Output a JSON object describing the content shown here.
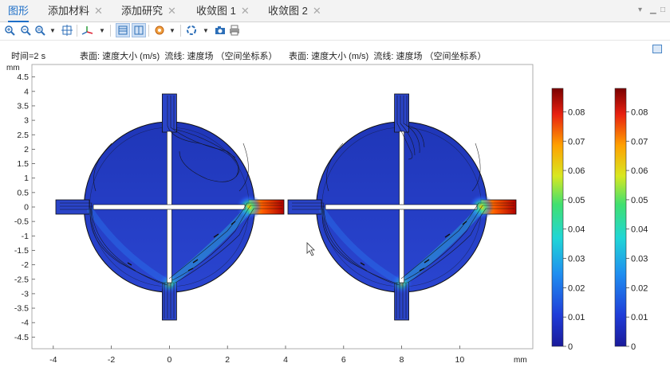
{
  "tabs": [
    {
      "label": "图形",
      "active": true,
      "closable": false
    },
    {
      "label": "添加材料",
      "active": false,
      "closable": true
    },
    {
      "label": "添加研究",
      "active": false,
      "closable": true
    },
    {
      "label": "收敛图 1",
      "active": false,
      "closable": true
    },
    {
      "label": "收敛图 2",
      "active": false,
      "closable": true
    }
  ],
  "toolbar": {
    "icons": [
      "zoom-in-icon",
      "zoom-out-icon",
      "zoom-box-icon",
      "zoom-extents-icon",
      "axis-orientation-icon",
      "grid-view-icon",
      "split-view-icon",
      "transparency-icon",
      "scene-light-icon",
      "camera-icon",
      "print-icon"
    ]
  },
  "plot": {
    "time_label": "时间=2 s",
    "left_title": "表面: 速度大小 (m/s)  流线: 速度场 （空间坐标系）",
    "right_title": "表面: 速度大小 (m/s)  流线: 速度场 （空间坐标系）",
    "unit": "mm",
    "x_ticks": [
      -4,
      -2,
      0,
      2,
      4,
      6,
      8,
      10
    ],
    "y_ticks": [
      4.5,
      4,
      3.5,
      3,
      2.5,
      2,
      1.5,
      1,
      0.5,
      0,
      -0.5,
      -1,
      -1.5,
      -2,
      -2.5,
      -3,
      -3.5,
      -4,
      -4.5
    ]
  },
  "colorbars": [
    {
      "ticks": [
        "0.08",
        "0.07",
        "0.06",
        "0.05",
        "0.04",
        "0.03",
        "0.02",
        "0.01",
        "0"
      ]
    },
    {
      "ticks": [
        "0.08",
        "0.07",
        "0.06",
        "0.05",
        "0.04",
        "0.03",
        "0.02",
        "0.01",
        "0"
      ]
    }
  ],
  "chart_data": {
    "type": "heatmap",
    "title": "表面: 速度大小 (m/s)  流线: 速度场 （空间坐标系）",
    "xlabel": "mm",
    "ylabel": "mm",
    "xlim": [
      -4.5,
      12.5
    ],
    "ylim": [
      -4.75,
      4.75
    ],
    "colorbar_range": [
      0,
      0.088
    ],
    "colormap": "rainbow (blue to red)"
  }
}
